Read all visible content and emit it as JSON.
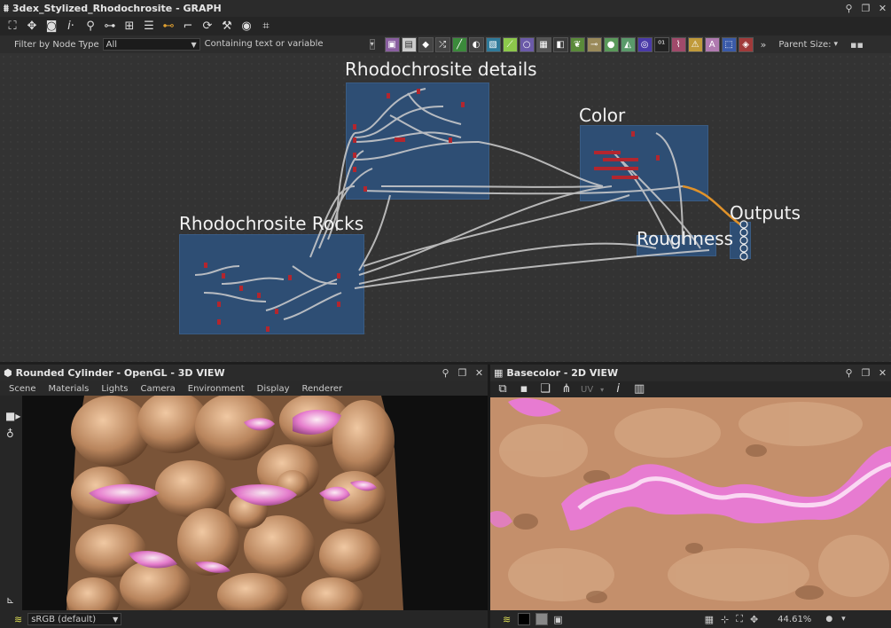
{
  "graph": {
    "title": "3dex_Stylized_Rhodochrosite - GRAPH",
    "filter_label": "Filter by Node Type",
    "filter_value": "All",
    "search_placeholder": "Containing text or variable",
    "parent_size_label": "Parent Size:",
    "frames": [
      {
        "title": "Rhodochrosite details"
      },
      {
        "title": "Color"
      },
      {
        "title": "Rhodochrosite Rocks"
      },
      {
        "title": "Outputs"
      },
      {
        "title": "Roughness"
      }
    ]
  },
  "view3d": {
    "title": "Rounded Cylinder - OpenGL - 3D VIEW",
    "menu": [
      "Scene",
      "Materials",
      "Lights",
      "Camera",
      "Environment",
      "Display",
      "Renderer"
    ],
    "colorspace": "sRGB (default)"
  },
  "view2d": {
    "title": "Basecolor - 2D VIEW",
    "uv_label": "UV",
    "zoom": "44.61%"
  },
  "colors": {
    "frame_blue": "#2e4e74",
    "node_red": "#b3262e",
    "orange_wire": "#e0922a",
    "rock_tan": "#c99470",
    "pink": "#e77bd1"
  }
}
